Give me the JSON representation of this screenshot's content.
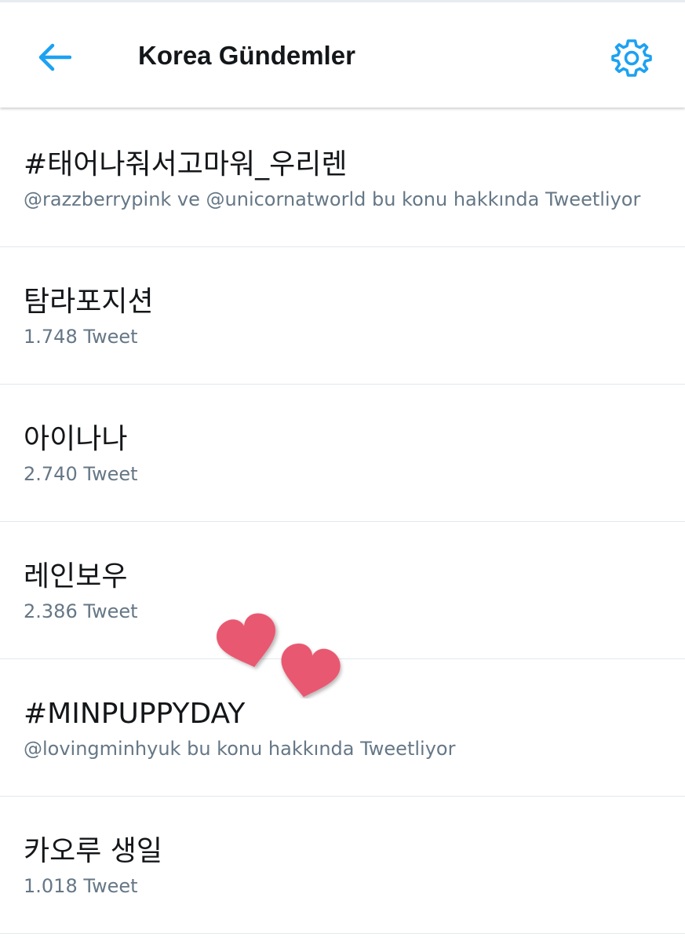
{
  "header": {
    "title": "Korea Gündemler",
    "back_icon": "arrow-left-icon",
    "settings_icon": "gear-icon",
    "accent_color": "#1da1f2"
  },
  "trends": [
    {
      "name": "#태어나줘서고마워_우리렌",
      "meta": "@razzberrypink ve @unicornatworld bu konu hakkında Tweetliyor"
    },
    {
      "name": "탐라포지션",
      "meta": "1.748 Tweet"
    },
    {
      "name": "아이나나",
      "meta": "2.740 Tweet"
    },
    {
      "name": "레인보우",
      "meta": "2.386 Tweet"
    },
    {
      "name": "#MINPUPPYDAY",
      "meta": "@lovingminhyuk bu konu hakkında Tweetliyor"
    },
    {
      "name": "카오루 생일",
      "meta": "1.018 Tweet"
    }
  ],
  "overlay": {
    "sticker": "two-hearts-sticker",
    "heart_color": "#e8586f"
  }
}
